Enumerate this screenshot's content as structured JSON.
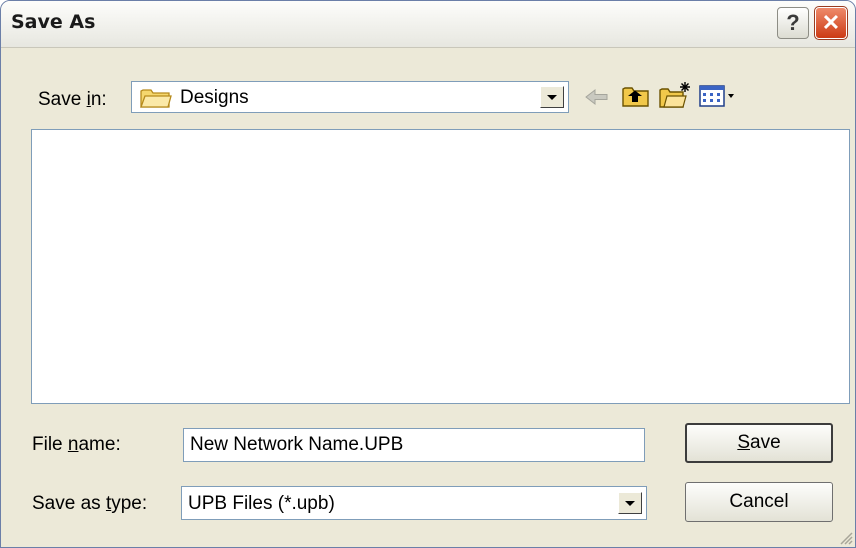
{
  "dialog": {
    "title": "Save As",
    "help_glyph": "?",
    "close_glyph": "✕"
  },
  "save_in": {
    "label_prefix": "Save ",
    "label_underline": "i",
    "label_suffix": "n:",
    "value": "Designs"
  },
  "toolbar": {
    "icons": [
      "back-arrow-icon",
      "up-one-level-icon",
      "create-new-folder-icon",
      "view-menu-icon"
    ]
  },
  "file_name": {
    "label_prefix": "File ",
    "label_underline": "n",
    "label_suffix": "ame:",
    "value": "New Network Name.UPB"
  },
  "save_as_type": {
    "label_prefix": "Save as ",
    "label_underline": "t",
    "label_suffix": "ype:",
    "value": "UPB Files (*.upb)"
  },
  "buttons": {
    "save_underline": "S",
    "save_rest": "ave",
    "cancel": "Cancel"
  }
}
